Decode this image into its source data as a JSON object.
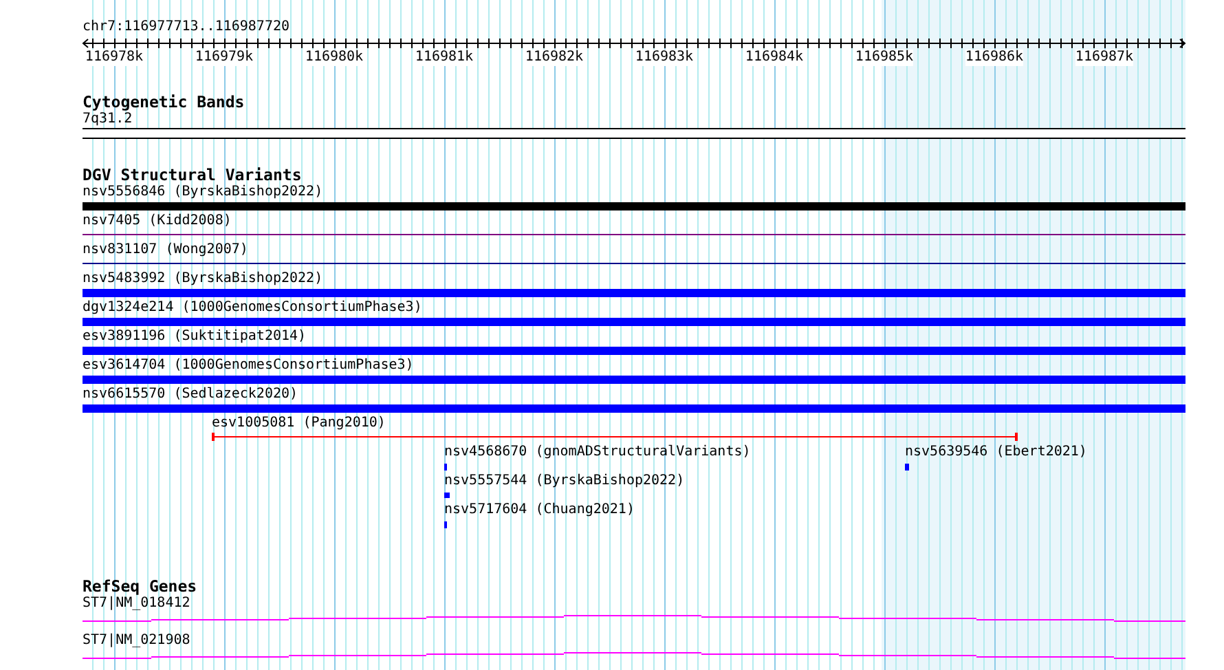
{
  "location": "chr7:116977713..116987720",
  "ruler": {
    "ticks": [
      "116978k",
      "116979k",
      "116980k",
      "116981k",
      "116982k",
      "116983k",
      "116984k",
      "116985k",
      "116986k",
      "116987k"
    ]
  },
  "cytogenetic_bands": {
    "title": "Cytogenetic Bands",
    "band": "7q31.2"
  },
  "structural_variants": {
    "title": "DGV Structural Variants",
    "lanes": [
      {
        "features": [
          {
            "label": "nsv5556846 (ByrskaBishop2022)",
            "kind": "bar",
            "color": "#000000"
          }
        ]
      },
      {
        "features": [
          {
            "label": "nsv7405 (Kidd2008)",
            "kind": "line",
            "color": "#800080"
          }
        ]
      },
      {
        "features": [
          {
            "label": "nsv831107 (Wong2007)",
            "kind": "line",
            "color": "#00008b"
          }
        ]
      },
      {
        "features": [
          {
            "label": "nsv5483992 (ByrskaBishop2022)",
            "kind": "bar",
            "color": "#0000ff"
          }
        ]
      },
      {
        "features": [
          {
            "label": "dgv1324e214 (1000GenomesConsortiumPhase3)",
            "kind": "bar",
            "color": "#0000ff"
          }
        ]
      },
      {
        "features": [
          {
            "label": "esv3891196 (Suktitipat2014)",
            "kind": "bar",
            "color": "#0000ff"
          }
        ]
      },
      {
        "features": [
          {
            "label": "esv3614704 (1000GenomesConsortiumPhase3)",
            "kind": "bar",
            "color": "#0000ff"
          }
        ]
      },
      {
        "features": [
          {
            "label": "nsv6615570 (Sedlazeck2020)",
            "kind": "bar",
            "color": "#0000ff"
          }
        ]
      },
      {
        "features": [
          {
            "label": "esv1005081 (Pang2010)",
            "kind": "span",
            "color": "#ff0000"
          }
        ]
      },
      {
        "features": [
          {
            "label": "nsv4568670 (gnomADStructuralVariants)",
            "kind": "mark",
            "color": "#0000ff"
          },
          {
            "label": "nsv5639546 (Ebert2021)",
            "kind": "mark",
            "color": "#0000ff"
          }
        ]
      },
      {
        "features": [
          {
            "label": "nsv5557544 (ByrskaBishop2022)",
            "kind": "mark",
            "color": "#0000ff"
          }
        ]
      },
      {
        "features": [
          {
            "label": "nsv5717604 (Chuang2021)",
            "kind": "mark",
            "color": "#0000ff"
          }
        ]
      }
    ]
  },
  "refseq_genes": {
    "title": "RefSeq Genes",
    "transcripts": [
      {
        "label": "ST7|NM_018412"
      },
      {
        "label": "ST7|NM_021908"
      }
    ]
  }
}
